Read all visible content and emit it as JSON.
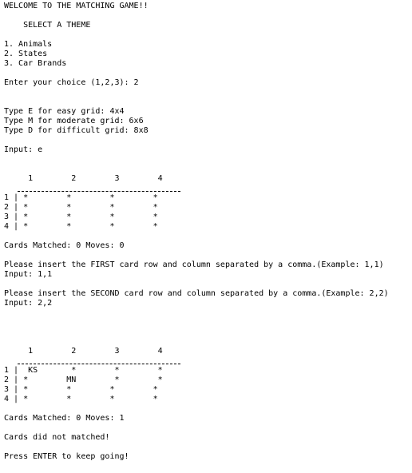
{
  "lines": [
    "WELCOME TO THE MATCHING GAME!!",
    "    SELECT A THEME",
    "1. Animals",
    "2. States",
    "3. Car Brands",
    "Enter your choice (1,2,3): 2",
    "Type E for easy grid: 4x4",
    "Type M for moderate grid: 6x6",
    "Type D for difficult grid: 8x8",
    "Input: e",
    "     1        2        3        4",
    "1 | *        *        *        *",
    "2 | *        *        *        *",
    "3 | *        *        *        *",
    "4 | *        *        *        *",
    "Cards Matched: 0 Moves: 0",
    "Please insert the FIRST card row and column separated by a comma.(Example: 1,1)",
    "Input: 1,1",
    "Please insert the SECOND card row and column separated by a comma.(Example: 2,2)",
    "Input: 2,2",
    "     1        2        3        4",
    "1 |  KS       *        *        *",
    "2 | *        MN        *        *",
    "3 | *        *        *        *",
    "4 | *        *        *        *",
    "Cards Matched: 0 Moves: 1",
    "Cards did not matched!",
    "Press ENTER to keep going!"
  ]
}
